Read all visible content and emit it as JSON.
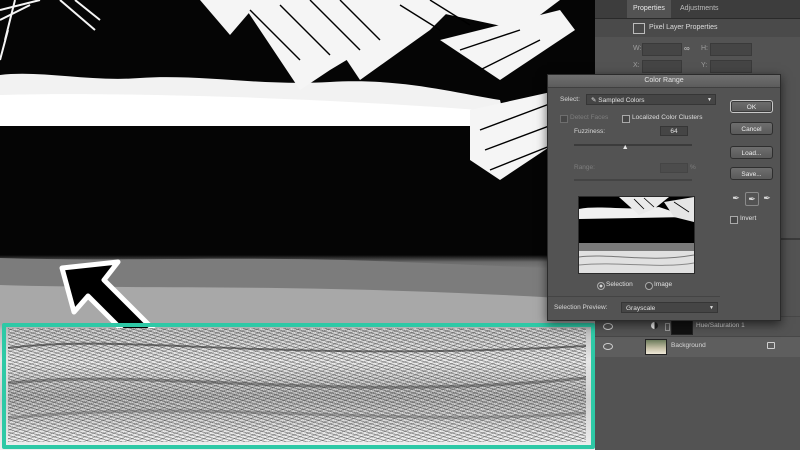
{
  "panels": {
    "tabs": [
      "Properties",
      "Adjustments"
    ],
    "header_title": "Pixel Layer Properties",
    "field_labels": {
      "w": "W:",
      "h": "H:",
      "x": "X:",
      "y": "Y:"
    },
    "link_icon": "link-icon"
  },
  "layers": [
    {
      "name": "Hue/Saturation 1",
      "icon": "adjustment-icon"
    },
    {
      "name": "Background",
      "icon": "lock-icon"
    }
  ],
  "dialog": {
    "title": "Color Range",
    "select_label": "Select:",
    "select_value": "Sampled Colors",
    "detect_faces": "Detect Faces",
    "localized_clusters": "Localized Color Clusters",
    "fuzziness_label": "Fuzziness:",
    "fuzziness_value": "64",
    "fuzziness_level": 0.43,
    "range_label": "Range:",
    "range_unit": "%",
    "selection_label": "Selection",
    "image_label": "Image",
    "preview_label": "Selection Preview:",
    "preview_value": "Grayscale",
    "ok": "OK",
    "cancel": "Cancel",
    "load": "Load...",
    "save": "Save...",
    "invert": "Invert",
    "droppers": [
      "eyedropper-icon",
      "eyedropper-plus-icon",
      "eyedropper-minus-icon"
    ]
  },
  "colors": {
    "highlight": "#2ec9a6",
    "panel": "#535353"
  }
}
